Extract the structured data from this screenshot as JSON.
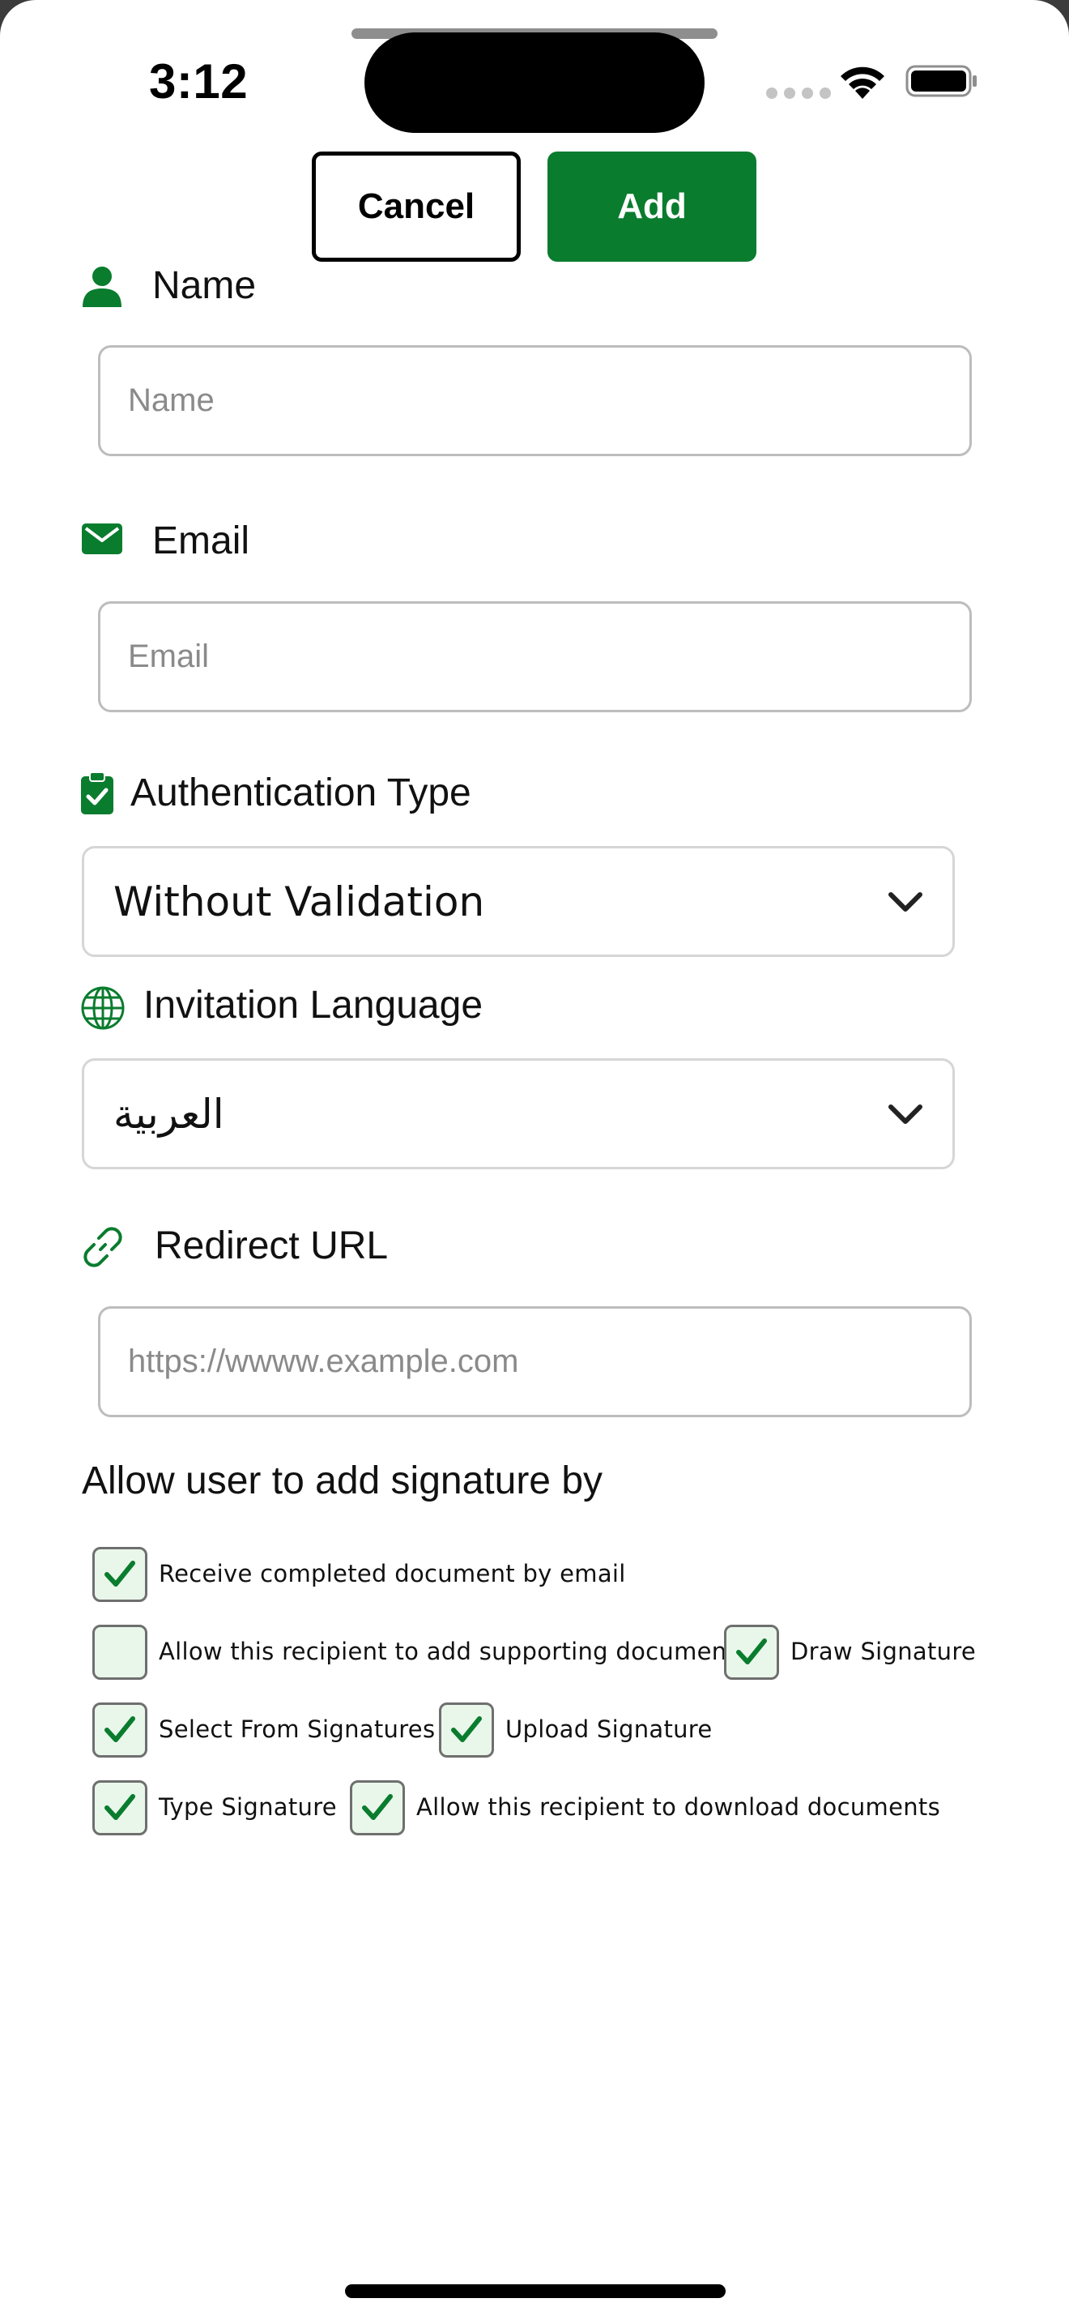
{
  "status_bar": {
    "time": "3:12"
  },
  "header": {
    "cancel_label": "Cancel",
    "add_label": "Add"
  },
  "form": {
    "name": {
      "label": "Name",
      "placeholder": "Name",
      "value": "",
      "icon": "person-icon"
    },
    "email": {
      "label": "Email",
      "placeholder": "Email",
      "value": "",
      "icon": "envelope-icon"
    },
    "auth_type": {
      "label": "Authentication Type",
      "selected": "Without Validation",
      "icon": "clipboard-check-icon"
    },
    "invitation_language": {
      "label": "Invitation Language",
      "selected": "العربية",
      "icon": "globe-icon"
    },
    "redirect_url": {
      "label": "Redirect URL",
      "placeholder": "https://wwww.example.com",
      "value": "",
      "icon": "link-icon"
    }
  },
  "signature_options": {
    "title": "Allow user to add signature by",
    "items": [
      {
        "label": "Receive completed document by email",
        "checked": true
      },
      {
        "label": "Allow this recipient to add supporting documents",
        "checked": false
      },
      {
        "label": "Draw Signature",
        "checked": true
      },
      {
        "label": "Select From Signatures",
        "checked": true
      },
      {
        "label": "Upload Signature",
        "checked": true
      },
      {
        "label": "Type Signature",
        "checked": true
      },
      {
        "label": "Allow this recipient to download documents",
        "checked": true
      }
    ]
  },
  "colors": {
    "accent": "#0a7c2e",
    "checkbox_bg": "#e9f7ea"
  }
}
